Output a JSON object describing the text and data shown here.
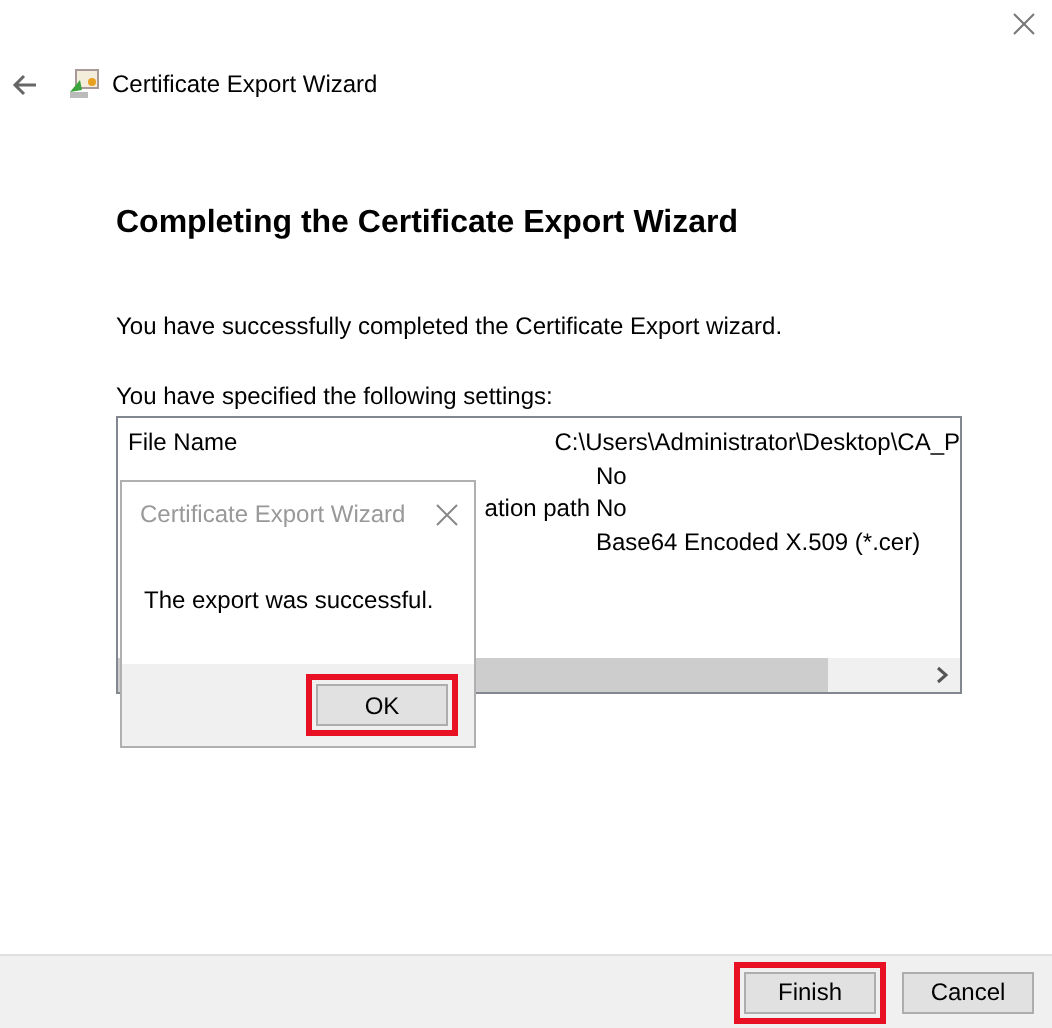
{
  "window": {
    "title": "Certificate Export Wizard"
  },
  "heading": "Completing the Certificate Export Wizard",
  "message": "You have successfully completed the Certificate Export wizard.",
  "settings_label": "You have specified the following settings:",
  "settings": [
    {
      "kind": "full",
      "label": "File Name",
      "value": "C:\\Users\\Administrator\\Desktop\\CA_P"
    },
    {
      "kind": "cut",
      "value": "No"
    },
    {
      "kind": "cut",
      "label": "ation path",
      "value": "No"
    },
    {
      "kind": "cut",
      "value": "Base64 Encoded X.509 (*.cer)"
    }
  ],
  "dialog": {
    "title": "Certificate Export Wizard",
    "message": "The export was successful.",
    "button": {
      "label": "OK",
      "highlighted": true
    }
  },
  "buttons": [
    {
      "label": "Finish",
      "highlighted": true
    },
    {
      "label": "Cancel",
      "highlighted": false
    }
  ]
}
